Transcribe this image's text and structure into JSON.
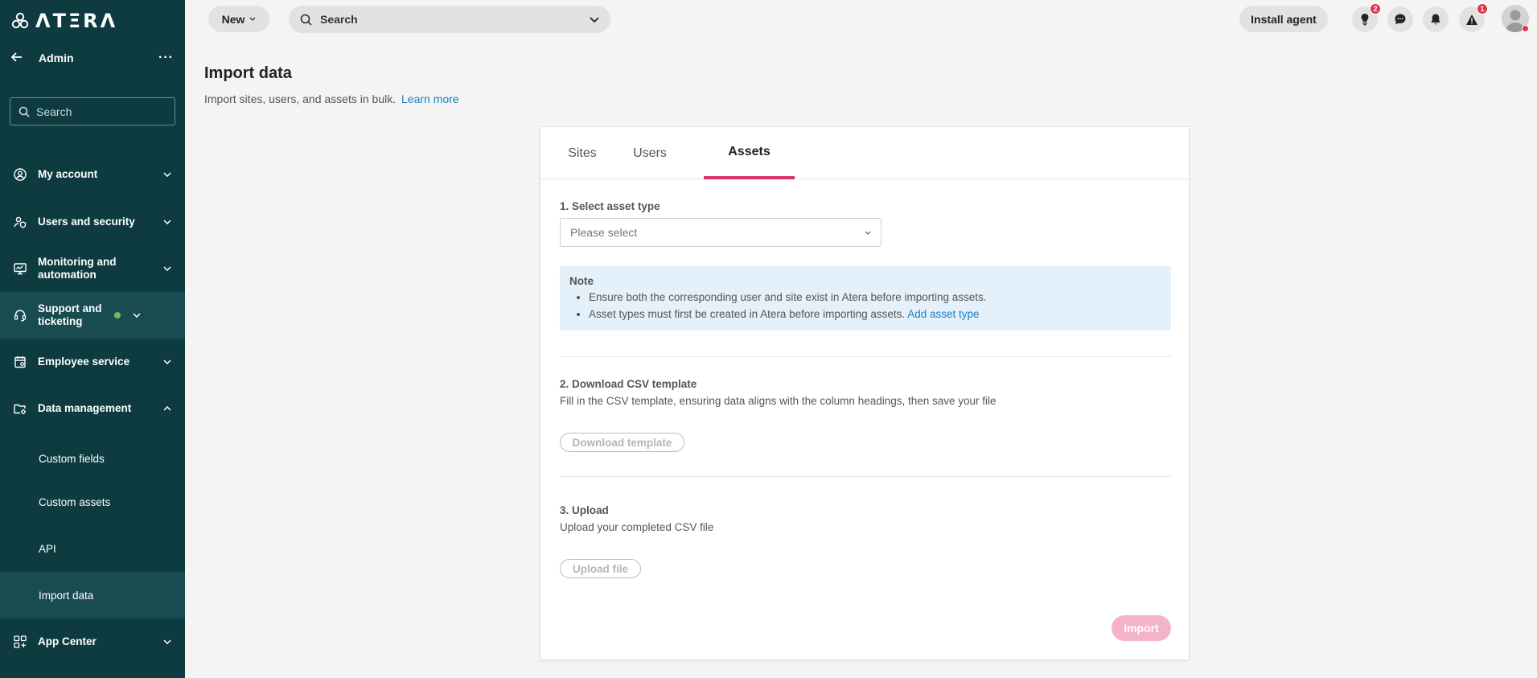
{
  "app": {
    "logo_text": "ΛTΞRΛ"
  },
  "sidebar": {
    "section_title": "Admin",
    "more_label": "···",
    "search_placeholder": "Search",
    "items": [
      {
        "label": "My account"
      },
      {
        "label": "Users and security"
      },
      {
        "label": "Monitoring and automation"
      },
      {
        "label": "Support and ticketing"
      },
      {
        "label": "Employee service"
      },
      {
        "label": "Data management"
      }
    ],
    "sub_items": [
      {
        "label": "Custom fields"
      },
      {
        "label": "Custom assets"
      },
      {
        "label": "API"
      },
      {
        "label": "Import data"
      }
    ],
    "app_center": {
      "label": "App Center"
    }
  },
  "topbar": {
    "new_label": "New",
    "search_label": "Search",
    "install_label": "Install agent",
    "tips_badge": "2",
    "alerts_badge": "1"
  },
  "page": {
    "title": "Import data",
    "subtitle": "Import sites, users, and assets in bulk.",
    "learn_more": "Learn more"
  },
  "tabs": [
    {
      "label": "Sites"
    },
    {
      "label": "Users"
    },
    {
      "label": "Assets",
      "active": true
    }
  ],
  "step1": {
    "title": "1. Select asset type",
    "select_value": "Please select"
  },
  "note": {
    "title": "Note",
    "line1": "Ensure both the corresponding user and site exist in Atera before importing assets.",
    "line2": "Asset types must first be created in Atera before importing assets.",
    "line2_link": "Add asset type"
  },
  "step2": {
    "title": "2. Download CSV template",
    "text": "Fill in the CSV template, ensuring data aligns with the column headings, then save your file",
    "button": "Download template"
  },
  "step3": {
    "title": "3. Upload",
    "text": "Upload your completed CSV file",
    "button": "Upload file"
  },
  "import_button": "Import",
  "colors": {
    "sidebar_bg": "#0d3b3f",
    "accent_pink": "#d9316f",
    "link_blue": "#1a7fc1",
    "note_bg": "#e4f0fa",
    "status_green": "#69c05a"
  }
}
